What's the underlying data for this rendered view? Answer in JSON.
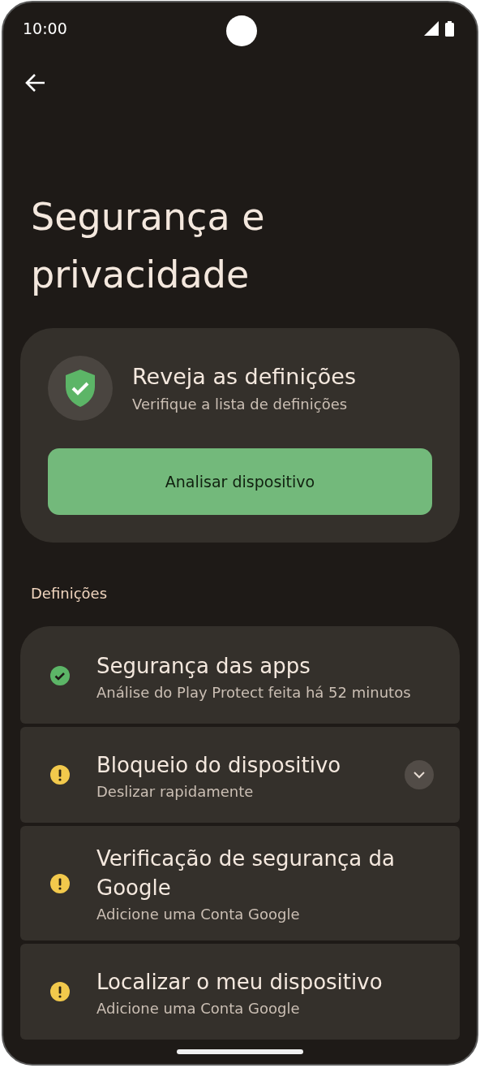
{
  "status_bar": {
    "time": "10:00"
  },
  "title": "Segurança e privacidade",
  "review_card": {
    "title": "Reveja as definições",
    "subtitle": "Verifique a lista de definições",
    "button": "Analisar dispositivo"
  },
  "section_header": "Definições",
  "items": [
    {
      "title": "Segurança das apps",
      "subtitle": "Análise do Play Protect feita há 52 minutos",
      "kind": "ok",
      "has_expand": false
    },
    {
      "title": "Bloqueio do dispositivo",
      "subtitle": "Deslizar rapidamente",
      "kind": "warning",
      "has_expand": true
    },
    {
      "title": "Verificação de segurança da Google",
      "subtitle": "Adicione uma Conta Google",
      "kind": "warning",
      "has_expand": false
    },
    {
      "title": "Localizar o meu dispositivo",
      "subtitle": "Adicione uma Conta Google",
      "kind": "warning",
      "has_expand": false
    }
  ]
}
